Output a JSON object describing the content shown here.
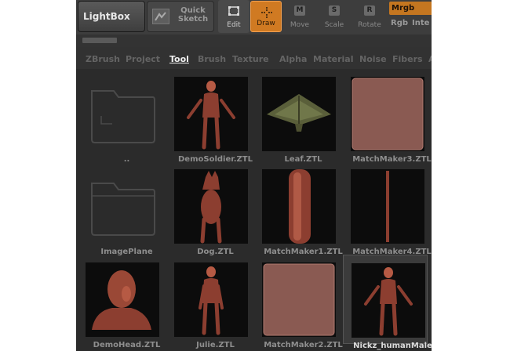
{
  "toolbar": {
    "lightbox_label": "LightBox",
    "quicksketch_label": "Quick Sketch",
    "edit_label": "Edit",
    "draw_label": "Draw",
    "move_label": "Move",
    "move_key": "M",
    "scale_label": "Scale",
    "scale_key": "S",
    "rotate_label": "Rotate",
    "rotate_key": "R",
    "mrgb_label": "Mrgb",
    "rgb_label": "Rgb",
    "inte_label": "Inte"
  },
  "menu": [
    "ZBrush",
    "Project",
    "Tool",
    "Brush",
    "Texture",
    "Alpha",
    "Material",
    "Noise",
    "Fibers",
    "A"
  ],
  "menu_active": "Tool",
  "files": [
    {
      "name": "..",
      "kind": "folder-up"
    },
    {
      "name": "DemoSoldier.ZTL",
      "kind": "soldier"
    },
    {
      "name": "Leaf.ZTL",
      "kind": "leaf"
    },
    {
      "name": "MatchMaker3.ZTL",
      "kind": "plane"
    },
    {
      "name": "ImagePlane",
      "kind": "folder"
    },
    {
      "name": "Dog.ZTL",
      "kind": "dog"
    },
    {
      "name": "MatchMaker1.ZTL",
      "kind": "cylinder"
    },
    {
      "name": "MatchMaker4.ZTL",
      "kind": "stick"
    },
    {
      "name": "DemoHead.ZTL",
      "kind": "head"
    },
    {
      "name": "Julie.ZTL",
      "kind": "julie"
    },
    {
      "name": "MatchMaker2.ZTL",
      "kind": "plane"
    },
    {
      "name": "Nickz_humanMale",
      "kind": "male",
      "selected": true
    }
  ],
  "colors": {
    "accent": "#d07a22",
    "panel": "#2e2e2e",
    "model": "#8c3e30"
  }
}
